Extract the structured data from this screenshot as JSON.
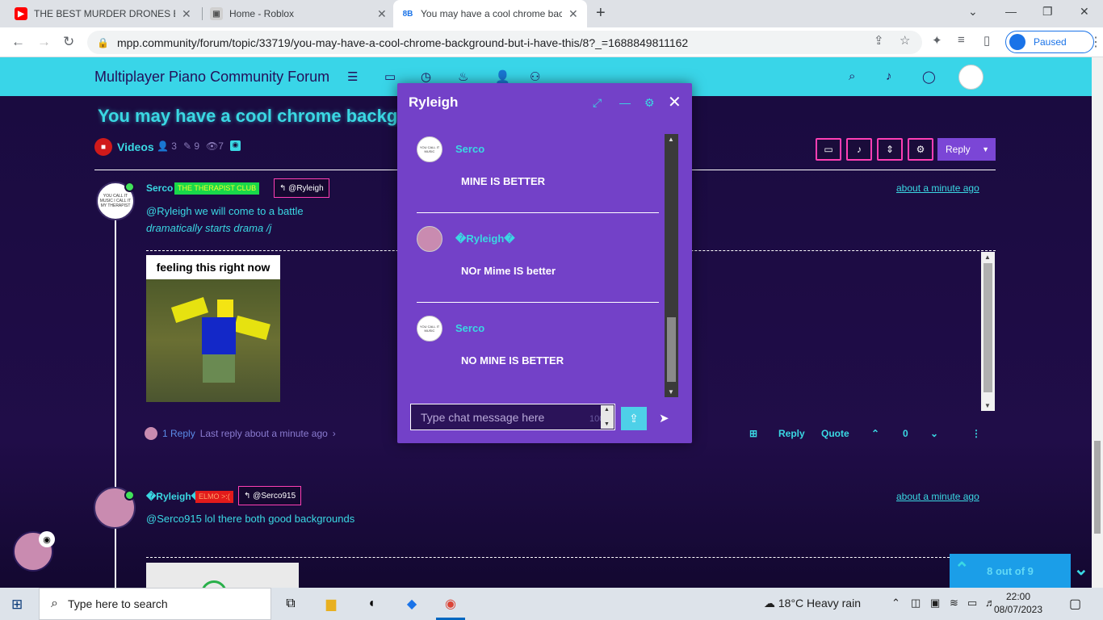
{
  "browser": {
    "tabs": [
      {
        "title": "THE BEST MURDER DRONES EDIT",
        "icon": "youtube-icon",
        "active": false
      },
      {
        "title": "Home - Roblox",
        "icon": "roblox-icon",
        "active": false
      },
      {
        "title": "You may have a cool chrome bac",
        "icon": "8b-icon",
        "active": true
      }
    ],
    "url": "mpp.community/forum/topic/33719/you-may-have-a-cool-chrome-background-but-i-have-this/8?_=1688849811162",
    "profile_label": "Paused",
    "favicon_8b": "8B"
  },
  "forum": {
    "brand": "Multiplayer Piano Community Forum",
    "topic_title": "You may have a cool chrome background but i have this",
    "category": "Videos",
    "stats": {
      "posters": "3",
      "posts": "9",
      "views": "7"
    },
    "reply_label": "Reply",
    "posts": [
      {
        "author": "Serco",
        "badge": "THE THERAPIST CLUB",
        "reply_to": "@Ryleigh",
        "time": "about a minute ago",
        "line1": "@Ryleigh we will come to a battle",
        "line2": "dramatically starts drama /j",
        "image_caption": "feeling this right now",
        "avatar_text": "YOU CALL IT MUSIC I CALL IT MY THERAPIST",
        "replies": "1 Reply",
        "last_reply": "Last reply about a minute ago",
        "actions": {
          "reply": "Reply",
          "quote": "Quote",
          "votes": "0"
        }
      },
      {
        "author": "�Ryleigh�",
        "badge": "ELMO >:(",
        "reply_to": "@Serco915",
        "time": "about a minute ago",
        "line1": "@Serco915 lol there both good backgrounds"
      }
    ],
    "pagination": "8 out of 9"
  },
  "chat": {
    "title": "Ryleigh",
    "messages": [
      {
        "author": "Serco",
        "text": "MINE IS BETTER",
        "avatar": "white"
      },
      {
        "author": "�Ryleigh�",
        "text": "NOr Mime IS better",
        "avatar": "pink"
      },
      {
        "author": "Serco",
        "text": "NO MINE IS BETTER",
        "avatar": "white"
      }
    ],
    "input_placeholder": "Type chat message here",
    "char_count": "1000"
  },
  "taskbar": {
    "search_placeholder": "Type here to search",
    "weather": "18°C  Heavy rain",
    "time": "22:00",
    "date": "08/07/2023"
  },
  "colors": {
    "accent": "#3ad8e3",
    "nav_bg": "#39d5e8",
    "chat_bg": "#7341c8",
    "tool_border": "#ff3fb4",
    "page_bg": "#1a0c3a"
  }
}
